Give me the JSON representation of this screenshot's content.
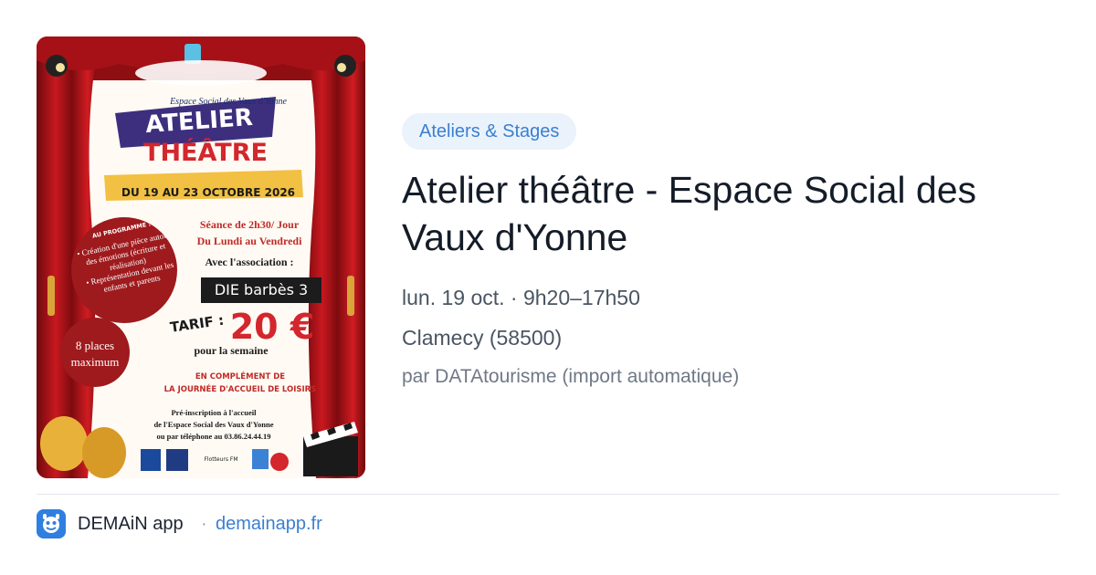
{
  "poster": {
    "organization": "Espace Social des Vaux d'Yonne",
    "heading_line1": "ATELIER",
    "heading_line2": "THÉÂTRE",
    "dates": "DU 19 AU 23 OCTOBRE 2026",
    "session_line1": "Séance de 2h30/ Jour",
    "session_line2": "Du Lundi au Vendredi",
    "programme_title": "AU PROGRAMME :",
    "programme_item1": "• Création d'une pièce autour des émotions (écriture et réalisation)",
    "programme_item2": "• Représentation devant les enfants et parents",
    "association_label": "Avec l'association :",
    "association_name": "DIE barbès 3",
    "tarif_label": "TARIF :",
    "price": "20 €",
    "price_period": "pour la semaine",
    "places": "8 places maximum",
    "complement_line1": "EN COMPLÉMENT DE",
    "complement_line2": "LA JOURNÉE D'ACCUEIL DE LOISIRS",
    "inscription_line1": "Pré-inscription à l'accueil",
    "inscription_line2": "de l'Espace Social des Vaux d'Yonne",
    "inscription_line3": "ou par téléphone au 03.86.24.44.19",
    "partner_flotteurs": "Flotteurs FM"
  },
  "event": {
    "category": "Ateliers & Stages",
    "title": "Atelier théâtre - Espace Social des Vaux d'Yonne",
    "when": "lun. 19 oct. · 9h20–17h50",
    "where": "Clamecy (58500)",
    "source": "par DATAtourisme (import automatique)"
  },
  "footer": {
    "app_name": "DEMAiN app",
    "separator": "·",
    "domain": "demainapp.fr"
  },
  "colors": {
    "accent": "#3b7fd0",
    "badge_bg": "#eaf2fb",
    "curtain_red": "#b5151b",
    "poster_red_text": "#d3262d"
  }
}
